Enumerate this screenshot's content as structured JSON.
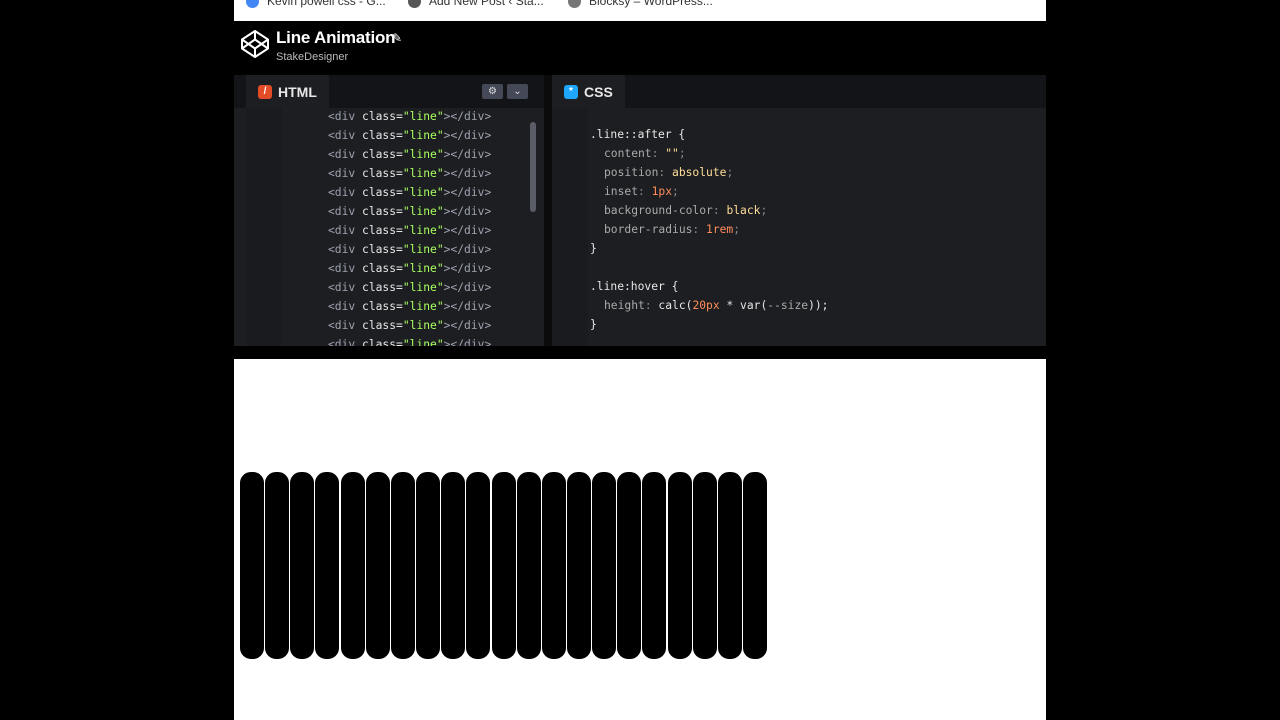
{
  "bookmarks": [
    {
      "label": "Kevin powell css - G...",
      "color": "#4285f4"
    },
    {
      "label": "Add New Post ‹ Sta...",
      "color": "#555555"
    },
    {
      "label": "Blocksy – WordPress...",
      "color": "#777777"
    }
  ],
  "pen": {
    "title": "Line Animation",
    "author": "StakeDesigner"
  },
  "html_editor": {
    "tab_label": "HTML",
    "lines": [
      {
        "n": "",
        "tag": "<div ",
        "attr": "class=",
        "str": "\"line\"",
        "end": "></div>"
      },
      {
        "n": "",
        "tag": "<div ",
        "attr": "class=",
        "str": "\"line\"",
        "end": "></div>"
      },
      {
        "n": "",
        "tag": "<div ",
        "attr": "class=",
        "str": "\"line\"",
        "end": "></div>"
      },
      {
        "n": "",
        "tag": "<div ",
        "attr": "class=",
        "str": "\"line\"",
        "end": "></div>"
      },
      {
        "n": "",
        "tag": "<div ",
        "attr": "class=",
        "str": "\"line\"",
        "end": "></div>"
      },
      {
        "n": "",
        "tag": "<div ",
        "attr": "class=",
        "str": "\"line\"",
        "end": "></div>"
      },
      {
        "n": "",
        "tag": "<div ",
        "attr": "class=",
        "str": "\"line\"",
        "end": "></div>"
      },
      {
        "n": "",
        "tag": "<div ",
        "attr": "class=",
        "str": "\"line\"",
        "end": "></div>"
      },
      {
        "n": "",
        "tag": "<div ",
        "attr": "class=",
        "str": "\"line\"",
        "end": "></div>"
      },
      {
        "n": "",
        "tag": "<div ",
        "attr": "class=",
        "str": "\"line\"",
        "end": "></div>"
      },
      {
        "n": "",
        "tag": "<div ",
        "attr": "class=",
        "str": "\"line\"",
        "end": "></div>"
      },
      {
        "n": "",
        "tag": "<div ",
        "attr": "class=",
        "str": "\"line\"",
        "end": "></div>"
      },
      {
        "n": "",
        "tag": "<div ",
        "attr": "class=",
        "str": "\"line\"",
        "end": "></div>"
      }
    ]
  },
  "css_editor": {
    "tab_label": "CSS",
    "lines": [
      {
        "indent": 0,
        "parts": [
          [
            "t-sel",
            ".line::after {"
          ]
        ]
      },
      {
        "indent": 1,
        "parts": [
          [
            "t-prop",
            "content"
          ],
          [
            "t-dim",
            ": "
          ],
          [
            "t-val",
            "\"\""
          ],
          [
            "t-dim",
            ";"
          ]
        ]
      },
      {
        "indent": 1,
        "parts": [
          [
            "t-prop",
            "position"
          ],
          [
            "t-dim",
            ": "
          ],
          [
            "t-val",
            "absolute"
          ],
          [
            "t-dim",
            ";"
          ]
        ]
      },
      {
        "indent": 1,
        "parts": [
          [
            "t-prop",
            "inset"
          ],
          [
            "t-dim",
            ": "
          ],
          [
            "t-num",
            "1px"
          ],
          [
            "t-dim",
            ";"
          ]
        ]
      },
      {
        "indent": 1,
        "parts": [
          [
            "t-prop",
            "background-color"
          ],
          [
            "t-dim",
            ": "
          ],
          [
            "t-val",
            "black"
          ],
          [
            "t-dim",
            ";"
          ]
        ]
      },
      {
        "indent": 1,
        "parts": [
          [
            "t-prop",
            "border-radius"
          ],
          [
            "t-dim",
            ": "
          ],
          [
            "t-num",
            "1rem"
          ],
          [
            "t-dim",
            ";"
          ]
        ]
      },
      {
        "indent": 0,
        "parts": [
          [
            "t-sel",
            "}"
          ]
        ]
      },
      {
        "indent": 0,
        "parts": []
      },
      {
        "indent": 0,
        "parts": [
          [
            "t-sel",
            ".line:hover {"
          ]
        ]
      },
      {
        "indent": 1,
        "parts": [
          [
            "t-prop",
            "height"
          ],
          [
            "t-dim",
            ": "
          ],
          [
            "t-fn",
            "calc("
          ],
          [
            "t-num",
            "20px"
          ],
          [
            "t-fn",
            " * var("
          ],
          [
            "t-prop",
            "--size"
          ],
          [
            "t-fn",
            "));"
          ]
        ]
      },
      {
        "indent": 0,
        "parts": [
          [
            "t-sel",
            "}"
          ]
        ]
      }
    ]
  },
  "colors": {
    "html_icon": "#e34c26",
    "css_icon": "#1ea7fd"
  },
  "preview": {
    "line_count": 21
  }
}
